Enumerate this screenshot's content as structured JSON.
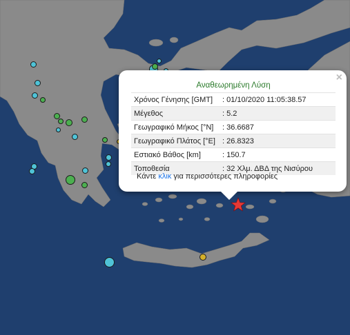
{
  "map": {
    "sea_color": "#1f3f6e",
    "land_color": "#8a8a8a",
    "earthquake_markers": [
      {
        "color": "#4fc3d7"
      },
      {
        "color": "#4fc3d7"
      },
      {
        "color": "#4fc3d7"
      },
      {
        "color": "#4caf50"
      },
      {
        "color": "#4caf50"
      },
      {
        "color": "#4caf50"
      },
      {
        "color": "#4caf50"
      },
      {
        "color": "#4caf50"
      },
      {
        "color": "#4fc3d7"
      },
      {
        "color": "#4fc3d7"
      },
      {
        "color": "#4fc3d7"
      },
      {
        "color": "#4fc3d7"
      },
      {
        "color": "#4fc3d7"
      },
      {
        "color": "#4fc3d7"
      },
      {
        "color": "#4caf50"
      },
      {
        "color": "#4caf50"
      },
      {
        "color": "#4fc3d7"
      },
      {
        "color": "#4caf50"
      },
      {
        "color": "#4fc3d7"
      },
      {
        "color": "#4fc3d7"
      },
      {
        "color": "#4fc3d7"
      },
      {
        "color": "#d4b02a"
      },
      {
        "color": "#4caf50"
      },
      {
        "color": "#d4b02a"
      },
      {
        "color": "#4fc3d7"
      },
      {
        "color": "#4fc3d7"
      },
      {
        "color": "#4fc3d7"
      }
    ],
    "epicenter_icon": "red-star-icon",
    "epicenter_color": "#e53935"
  },
  "popup": {
    "title": "Αναθεωρημένη Λύση",
    "close_icon": "×",
    "rows": [
      {
        "label": "Χρόνος Γένησης [GMT]",
        "value": ": 01/10/2020 11:05:38.57"
      },
      {
        "label": "Μέγεθος",
        "value": ": 5.2"
      },
      {
        "label": "Γεωγραφικό Μήκος [°N]",
        "value": ": 36.6687"
      },
      {
        "label": "Γεωγραφικό Πλάτος [°E]",
        "value": ": 26.8323"
      },
      {
        "label": "Εστιακό Βάθος [km]",
        "value": ": 150.7"
      },
      {
        "label": "Τοποθεσία",
        "value": ": 32 Χλμ. ΔΒΔ της Νισύρου"
      }
    ],
    "more_prefix": "Κάντε",
    "more_link": "κλικ",
    "more_suffix": "για περισσότερες πληροφορίες"
  }
}
